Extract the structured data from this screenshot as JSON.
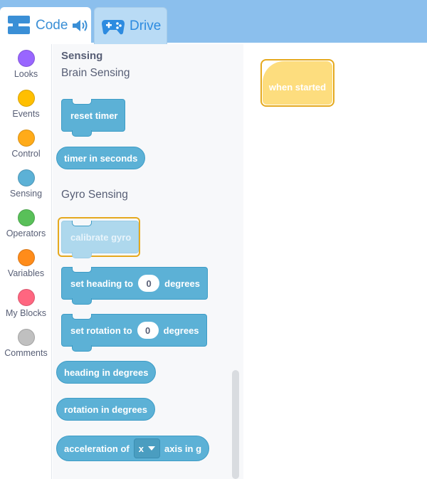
{
  "tabs": {
    "code_label": "Code",
    "drive_label": "Drive"
  },
  "categories": [
    {
      "label": "Looks",
      "color": "#9966ff"
    },
    {
      "label": "Events",
      "color": "#ffbf00"
    },
    {
      "label": "Control",
      "color": "#ffab19"
    },
    {
      "label": "Sensing",
      "color": "#5cb1d6"
    },
    {
      "label": "Operators",
      "color": "#59c059"
    },
    {
      "label": "Variables",
      "color": "#ff8c1a"
    },
    {
      "label": "My Blocks",
      "color": "#ff6680"
    },
    {
      "label": "Comments",
      "color": "#c0c0c0"
    }
  ],
  "flyout": {
    "title": "Sensing",
    "brain_section": "Brain Sensing",
    "gyro_section": "Gyro Sensing",
    "blocks": {
      "reset_timer": "reset timer",
      "timer_in_seconds": "timer in seconds",
      "calibrate_gyro": "calibrate gyro",
      "set_heading_prefix": "set heading to",
      "set_heading_value": "0",
      "set_heading_suffix": "degrees",
      "set_rotation_prefix": "set rotation to",
      "set_rotation_value": "0",
      "set_rotation_suffix": "degrees",
      "heading_in_degrees": "heading in degrees",
      "rotation_in_degrees": "rotation in degrees",
      "acceleration_prefix": "acceleration of",
      "acceleration_axis": "x",
      "acceleration_suffix": "axis in g"
    }
  },
  "canvas": {
    "event_block": "when started"
  },
  "colors": {
    "sensing": "#5cb1d6",
    "highlight": "#e5a91e",
    "events": "#fddd7e"
  },
  "icons": {
    "code": "code-blocks-icon",
    "sound": "speaker-icon",
    "drive": "gamepad-icon"
  }
}
